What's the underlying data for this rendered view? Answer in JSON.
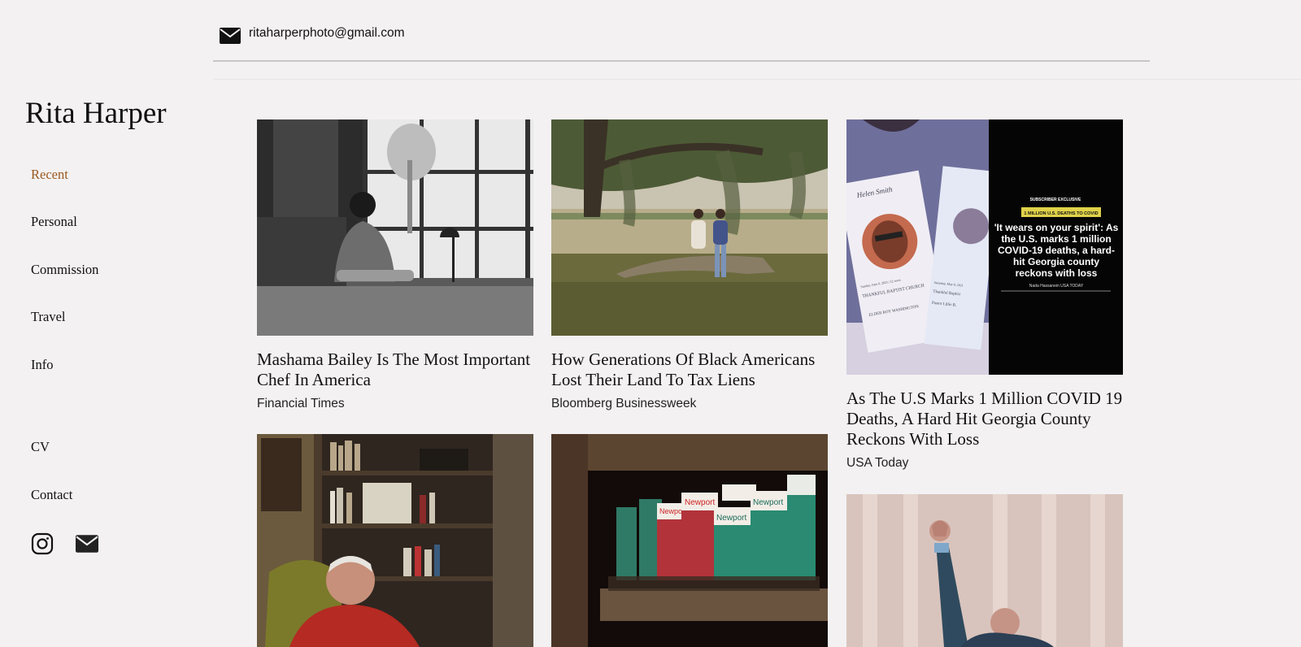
{
  "header": {
    "email": "ritaharperphoto@gmail.com"
  },
  "sidebar": {
    "site_title": "Rita Harper",
    "nav": [
      {
        "label": "Recent",
        "active": true
      },
      {
        "label": "Personal"
      },
      {
        "label": "Commission"
      },
      {
        "label": "Travel"
      },
      {
        "label": "Info"
      },
      {
        "label": "CV"
      },
      {
        "label": "Contact"
      }
    ],
    "social": [
      "instagram-icon",
      "mail-icon"
    ]
  },
  "colors": {
    "background": "#f3f1f2",
    "active_nav": "#9b5a1e",
    "text": "#111111"
  },
  "gallery": [
    {
      "title": "Mashama Bailey Is The Most Important Chef In America",
      "publication": "Financial Times"
    },
    {
      "title": "How Generations Of Black Americans Lost Their Land To Tax Liens",
      "publication": "Bloomberg Businessweek"
    },
    {
      "title": "As The U.S Marks 1 Million COVID 19 Deaths, A Hard Hit Georgia County Reckons With Loss",
      "publication": "USA Today",
      "overlay": {
        "kicker": "SUBSCRIBER EXCLUSIVE",
        "tag": "1 MILLION U.S. DEATHS TO COVID",
        "headline": [
          "'It wears on your spirit': As",
          "the U.S. marks 1 million",
          "COVID-19 deaths, a hard-",
          "hit Georgia county",
          "reckons with loss"
        ],
        "byline": "Nada Hassanein USA TODAY"
      },
      "program_text": [
        "Helen Smith",
        "Sunday, June 6, 2021 | 12 noon",
        "THANKFUL BAPTIST CHURCH",
        "ELDER ROY WASHINGTON",
        "Saturday, May 8, 2021",
        "Thankful Baptist",
        "Pastor Lillie B."
      ]
    },
    {
      "title": "",
      "publication": ""
    },
    {
      "title": "",
      "publication": "",
      "product_label": "Newport"
    },
    {
      "title": "",
      "publication": ""
    }
  ]
}
